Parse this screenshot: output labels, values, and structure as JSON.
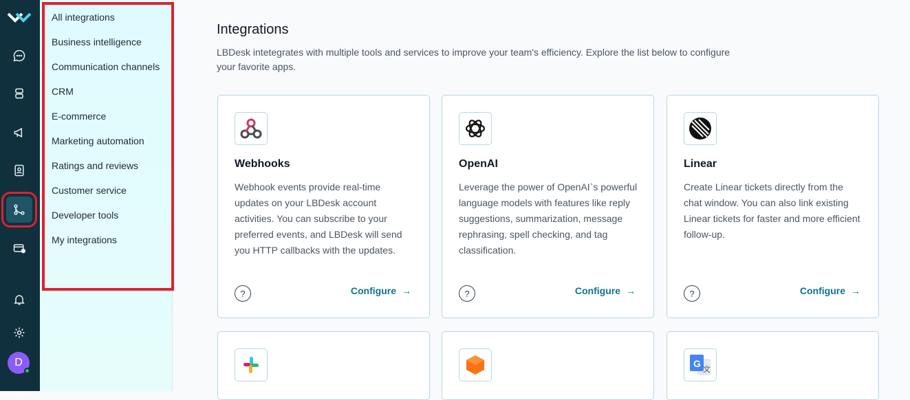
{
  "rail": {
    "icons": [
      "logo-icon",
      "chat-icon",
      "database-icon",
      "megaphone-icon",
      "contacts-icon",
      "integrations-icon",
      "wallet-icon",
      "bell-icon",
      "gear-icon"
    ],
    "avatar_initial": "D",
    "accent": "#e0212f",
    "background": "#10303d"
  },
  "subnav": {
    "items": [
      "All integrations",
      "Business intelligence",
      "Communication channels",
      "CRM",
      "E-commerce",
      "Marketing automation",
      "Ratings and reviews",
      "Customer service",
      "Developer tools",
      "My integrations"
    ]
  },
  "main": {
    "title": "Integrations",
    "description": "LBDesk intetegrates with multiple tools and services to improve your team's efficiency. Explore the list below to configure your favorite apps.",
    "cards": [
      {
        "name": "Webhooks",
        "icon": "webhooks-icon",
        "description": "Webhook events provide real-time updates on your LBDesk account activities. You can subscribe to your preferred events, and LBDesk will send you HTTP callbacks with the updates.",
        "help": "?",
        "configure": "Configure"
      },
      {
        "name": "OpenAI",
        "icon": "openai-icon",
        "description": "Leverage the power of OpenAI`s powerful language models with features like reply suggestions, summarization, message rephrasing, spell checking, and tag classification.",
        "help": "?",
        "configure": "Configure"
      },
      {
        "name": "Linear",
        "icon": "linear-icon",
        "description": "Create Linear tickets directly from the chat window. You can also link existing Linear tickets for faster and more efficient follow-up.",
        "help": "?",
        "configure": "Configure"
      },
      {
        "icon": "slack-icon"
      },
      {
        "icon": "box-icon"
      },
      {
        "icon": "google-translate-icon"
      }
    ]
  }
}
